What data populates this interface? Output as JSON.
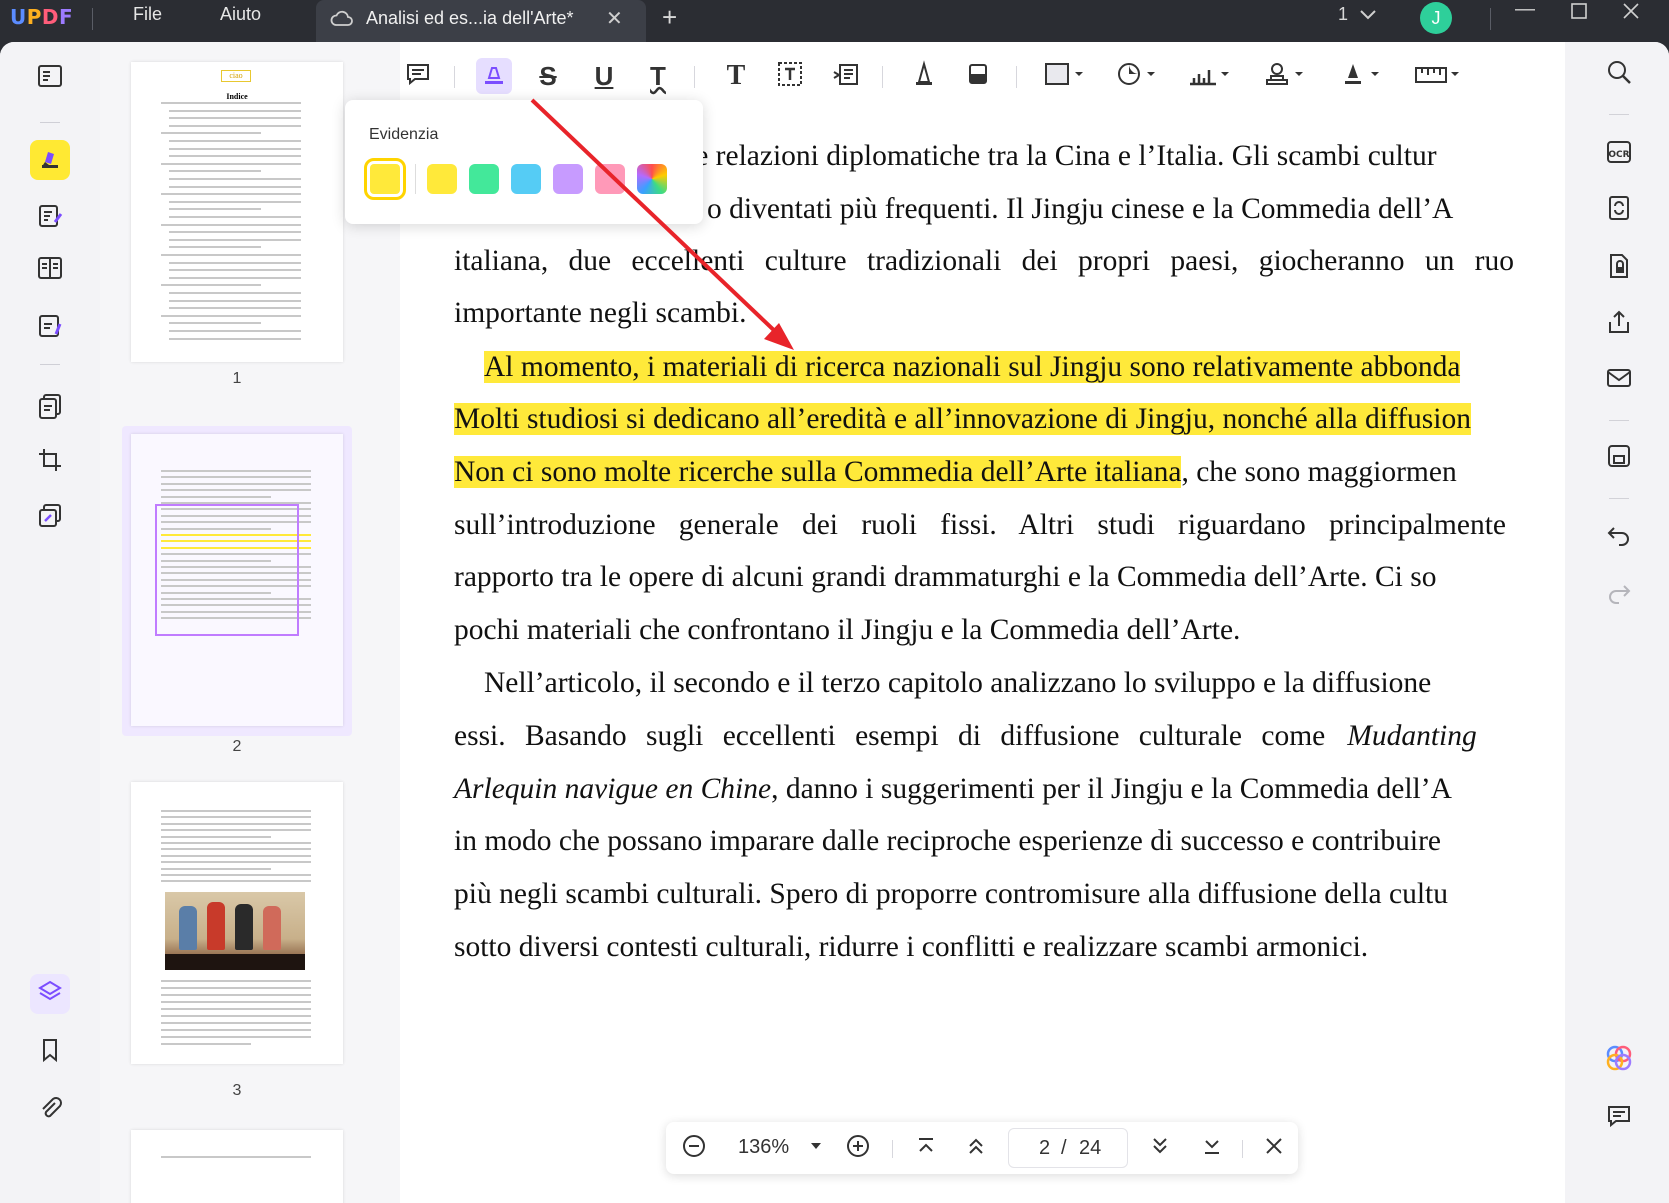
{
  "app": {
    "logo": "UPDF",
    "menu": [
      "File",
      "Aiuto"
    ]
  },
  "tab": {
    "title": "Analisi ed es...ia dell'Arte*",
    "close": "✕",
    "new": "+"
  },
  "titlebar": {
    "page_indicator": "1",
    "avatar_initial": "J",
    "window_controls": [
      "minimize",
      "maximize",
      "close"
    ]
  },
  "toolbar": {
    "tools": [
      "comment-icon",
      "highlight-icon",
      "strikethrough-icon",
      "underline-icon",
      "squiggly-icon",
      "text-icon",
      "textbox-icon",
      "text-callout-icon",
      "pencil-icon",
      "eraser-icon",
      "shape-icon",
      "sticker-icon",
      "chart-icon",
      "stamp-icon",
      "signature-icon",
      "ruler-icon"
    ]
  },
  "popup": {
    "title": "Evidenzia",
    "colors": [
      "#ffe93a",
      "#ffe93a",
      "#43e89a",
      "#55ccf5",
      "#c79bff",
      "#ff99b8",
      "rainbow"
    ],
    "selected_index": 0
  },
  "document": {
    "lines": [
      "le relazioni diplomatiche tra la Cina e l’Italia. Gli scambi cultur",
      "o diventati più frequenti. Il Jingju cinese e la Commedia dell’A",
      "italiana, due eccellenti culture tradizionali dei propri paesi, giocheranno un ruo",
      "importante negli scambi.",
      "Al momento, i materiali di ricerca nazionali sul Jingju sono relativamente abbonda",
      "Molti studiosi si dedicano all’eredità e all’innovazione di Jingju, nonché alla diffusion",
      "Non ci sono molte ricerche sulla Commedia dell’Arte italiana",
      ", che sono maggiormen",
      "sull’introduzione generale dei ruoli fissi. Altri studi riguardano principalmente",
      "rapporto tra le opere di alcuni grandi drammaturghi e la Commedia dell’Arte. Ci so",
      "pochi materiali che confrontano il Jingju e la Commedia dell’Arte.",
      "Nell’articolo, il secondo e il terzo capitolo analizzano lo sviluppo e la diffusione",
      "essi. Basando sugli eccellenti esempi di diffusione culturale come",
      "Mudanting",
      "Arlequin navigue en Chine",
      ", danno i suggerimenti per il Jingju e la Commedia dell’A",
      "in modo che possano imparare dalle reciproche esperienze di successo e contribuire",
      "più negli scambi culturali. Spero di proporre contromisure alla diffusione della cultu",
      "sotto diversi contesti culturali, ridurre i conflitti e realizzare scambi armonici."
    ]
  },
  "thumbnails": {
    "pages": [
      "1",
      "2",
      "3"
    ],
    "selected": "2",
    "page1_header": "ciao",
    "page1_title": "Indice"
  },
  "navbar": {
    "zoom": "136%",
    "current_page": "2",
    "separator": "/",
    "total_pages": "24"
  },
  "colors": {
    "highlight": "#ffe93a",
    "accent": "#7b4dff",
    "arrow": "#e8242a",
    "titlebar_bg": "#2b2d33"
  }
}
